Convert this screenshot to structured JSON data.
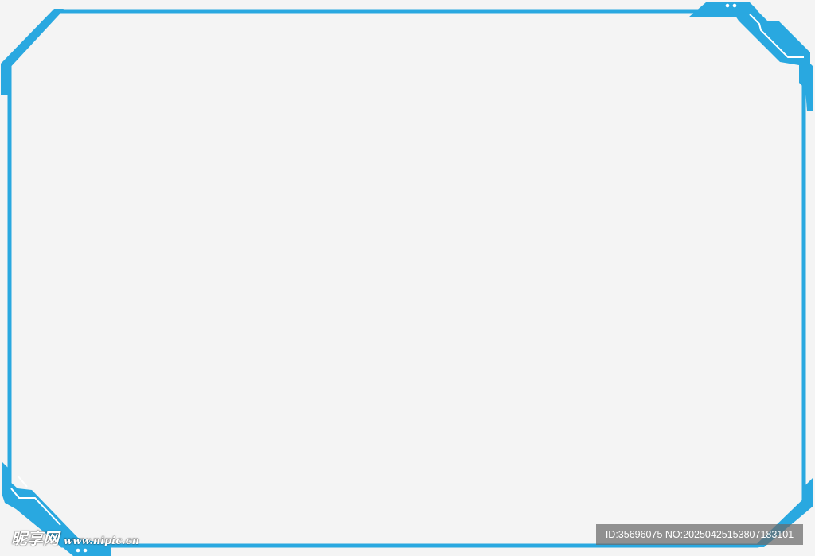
{
  "frame": {
    "stroke_color": "#29a8e0",
    "background_color": "#f4f4f4",
    "accent_dot_color": "#ffffff"
  },
  "watermark": {
    "logo_text": "昵享网",
    "site_text": "www.nipic.cn",
    "id_text": "ID:35696075 NO:20250425153807183101"
  }
}
